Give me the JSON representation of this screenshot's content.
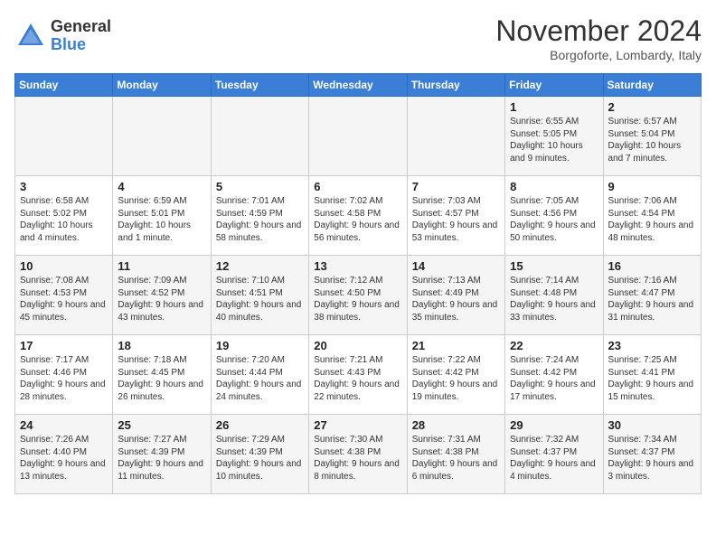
{
  "header": {
    "logo": {
      "general": "General",
      "blue": "Blue"
    },
    "title": "November 2024",
    "location": "Borgoforte, Lombardy, Italy"
  },
  "days_of_week": [
    "Sunday",
    "Monday",
    "Tuesday",
    "Wednesday",
    "Thursday",
    "Friday",
    "Saturday"
  ],
  "weeks": [
    [
      {
        "day": "",
        "info": ""
      },
      {
        "day": "",
        "info": ""
      },
      {
        "day": "",
        "info": ""
      },
      {
        "day": "",
        "info": ""
      },
      {
        "day": "",
        "info": ""
      },
      {
        "day": "1",
        "info": "Sunrise: 6:55 AM\nSunset: 5:05 PM\nDaylight: 10 hours and 9 minutes."
      },
      {
        "day": "2",
        "info": "Sunrise: 6:57 AM\nSunset: 5:04 PM\nDaylight: 10 hours and 7 minutes."
      }
    ],
    [
      {
        "day": "3",
        "info": "Sunrise: 6:58 AM\nSunset: 5:02 PM\nDaylight: 10 hours and 4 minutes."
      },
      {
        "day": "4",
        "info": "Sunrise: 6:59 AM\nSunset: 5:01 PM\nDaylight: 10 hours and 1 minute."
      },
      {
        "day": "5",
        "info": "Sunrise: 7:01 AM\nSunset: 4:59 PM\nDaylight: 9 hours and 58 minutes."
      },
      {
        "day": "6",
        "info": "Sunrise: 7:02 AM\nSunset: 4:58 PM\nDaylight: 9 hours and 56 minutes."
      },
      {
        "day": "7",
        "info": "Sunrise: 7:03 AM\nSunset: 4:57 PM\nDaylight: 9 hours and 53 minutes."
      },
      {
        "day": "8",
        "info": "Sunrise: 7:05 AM\nSunset: 4:56 PM\nDaylight: 9 hours and 50 minutes."
      },
      {
        "day": "9",
        "info": "Sunrise: 7:06 AM\nSunset: 4:54 PM\nDaylight: 9 hours and 48 minutes."
      }
    ],
    [
      {
        "day": "10",
        "info": "Sunrise: 7:08 AM\nSunset: 4:53 PM\nDaylight: 9 hours and 45 minutes."
      },
      {
        "day": "11",
        "info": "Sunrise: 7:09 AM\nSunset: 4:52 PM\nDaylight: 9 hours and 43 minutes."
      },
      {
        "day": "12",
        "info": "Sunrise: 7:10 AM\nSunset: 4:51 PM\nDaylight: 9 hours and 40 minutes."
      },
      {
        "day": "13",
        "info": "Sunrise: 7:12 AM\nSunset: 4:50 PM\nDaylight: 9 hours and 38 minutes."
      },
      {
        "day": "14",
        "info": "Sunrise: 7:13 AM\nSunset: 4:49 PM\nDaylight: 9 hours and 35 minutes."
      },
      {
        "day": "15",
        "info": "Sunrise: 7:14 AM\nSunset: 4:48 PM\nDaylight: 9 hours and 33 minutes."
      },
      {
        "day": "16",
        "info": "Sunrise: 7:16 AM\nSunset: 4:47 PM\nDaylight: 9 hours and 31 minutes."
      }
    ],
    [
      {
        "day": "17",
        "info": "Sunrise: 7:17 AM\nSunset: 4:46 PM\nDaylight: 9 hours and 28 minutes."
      },
      {
        "day": "18",
        "info": "Sunrise: 7:18 AM\nSunset: 4:45 PM\nDaylight: 9 hours and 26 minutes."
      },
      {
        "day": "19",
        "info": "Sunrise: 7:20 AM\nSunset: 4:44 PM\nDaylight: 9 hours and 24 minutes."
      },
      {
        "day": "20",
        "info": "Sunrise: 7:21 AM\nSunset: 4:43 PM\nDaylight: 9 hours and 22 minutes."
      },
      {
        "day": "21",
        "info": "Sunrise: 7:22 AM\nSunset: 4:42 PM\nDaylight: 9 hours and 19 minutes."
      },
      {
        "day": "22",
        "info": "Sunrise: 7:24 AM\nSunset: 4:42 PM\nDaylight: 9 hours and 17 minutes."
      },
      {
        "day": "23",
        "info": "Sunrise: 7:25 AM\nSunset: 4:41 PM\nDaylight: 9 hours and 15 minutes."
      }
    ],
    [
      {
        "day": "24",
        "info": "Sunrise: 7:26 AM\nSunset: 4:40 PM\nDaylight: 9 hours and 13 minutes."
      },
      {
        "day": "25",
        "info": "Sunrise: 7:27 AM\nSunset: 4:39 PM\nDaylight: 9 hours and 11 minutes."
      },
      {
        "day": "26",
        "info": "Sunrise: 7:29 AM\nSunset: 4:39 PM\nDaylight: 9 hours and 10 minutes."
      },
      {
        "day": "27",
        "info": "Sunrise: 7:30 AM\nSunset: 4:38 PM\nDaylight: 9 hours and 8 minutes."
      },
      {
        "day": "28",
        "info": "Sunrise: 7:31 AM\nSunset: 4:38 PM\nDaylight: 9 hours and 6 minutes."
      },
      {
        "day": "29",
        "info": "Sunrise: 7:32 AM\nSunset: 4:37 PM\nDaylight: 9 hours and 4 minutes."
      },
      {
        "day": "30",
        "info": "Sunrise: 7:34 AM\nSunset: 4:37 PM\nDaylight: 9 hours and 3 minutes."
      }
    ]
  ]
}
